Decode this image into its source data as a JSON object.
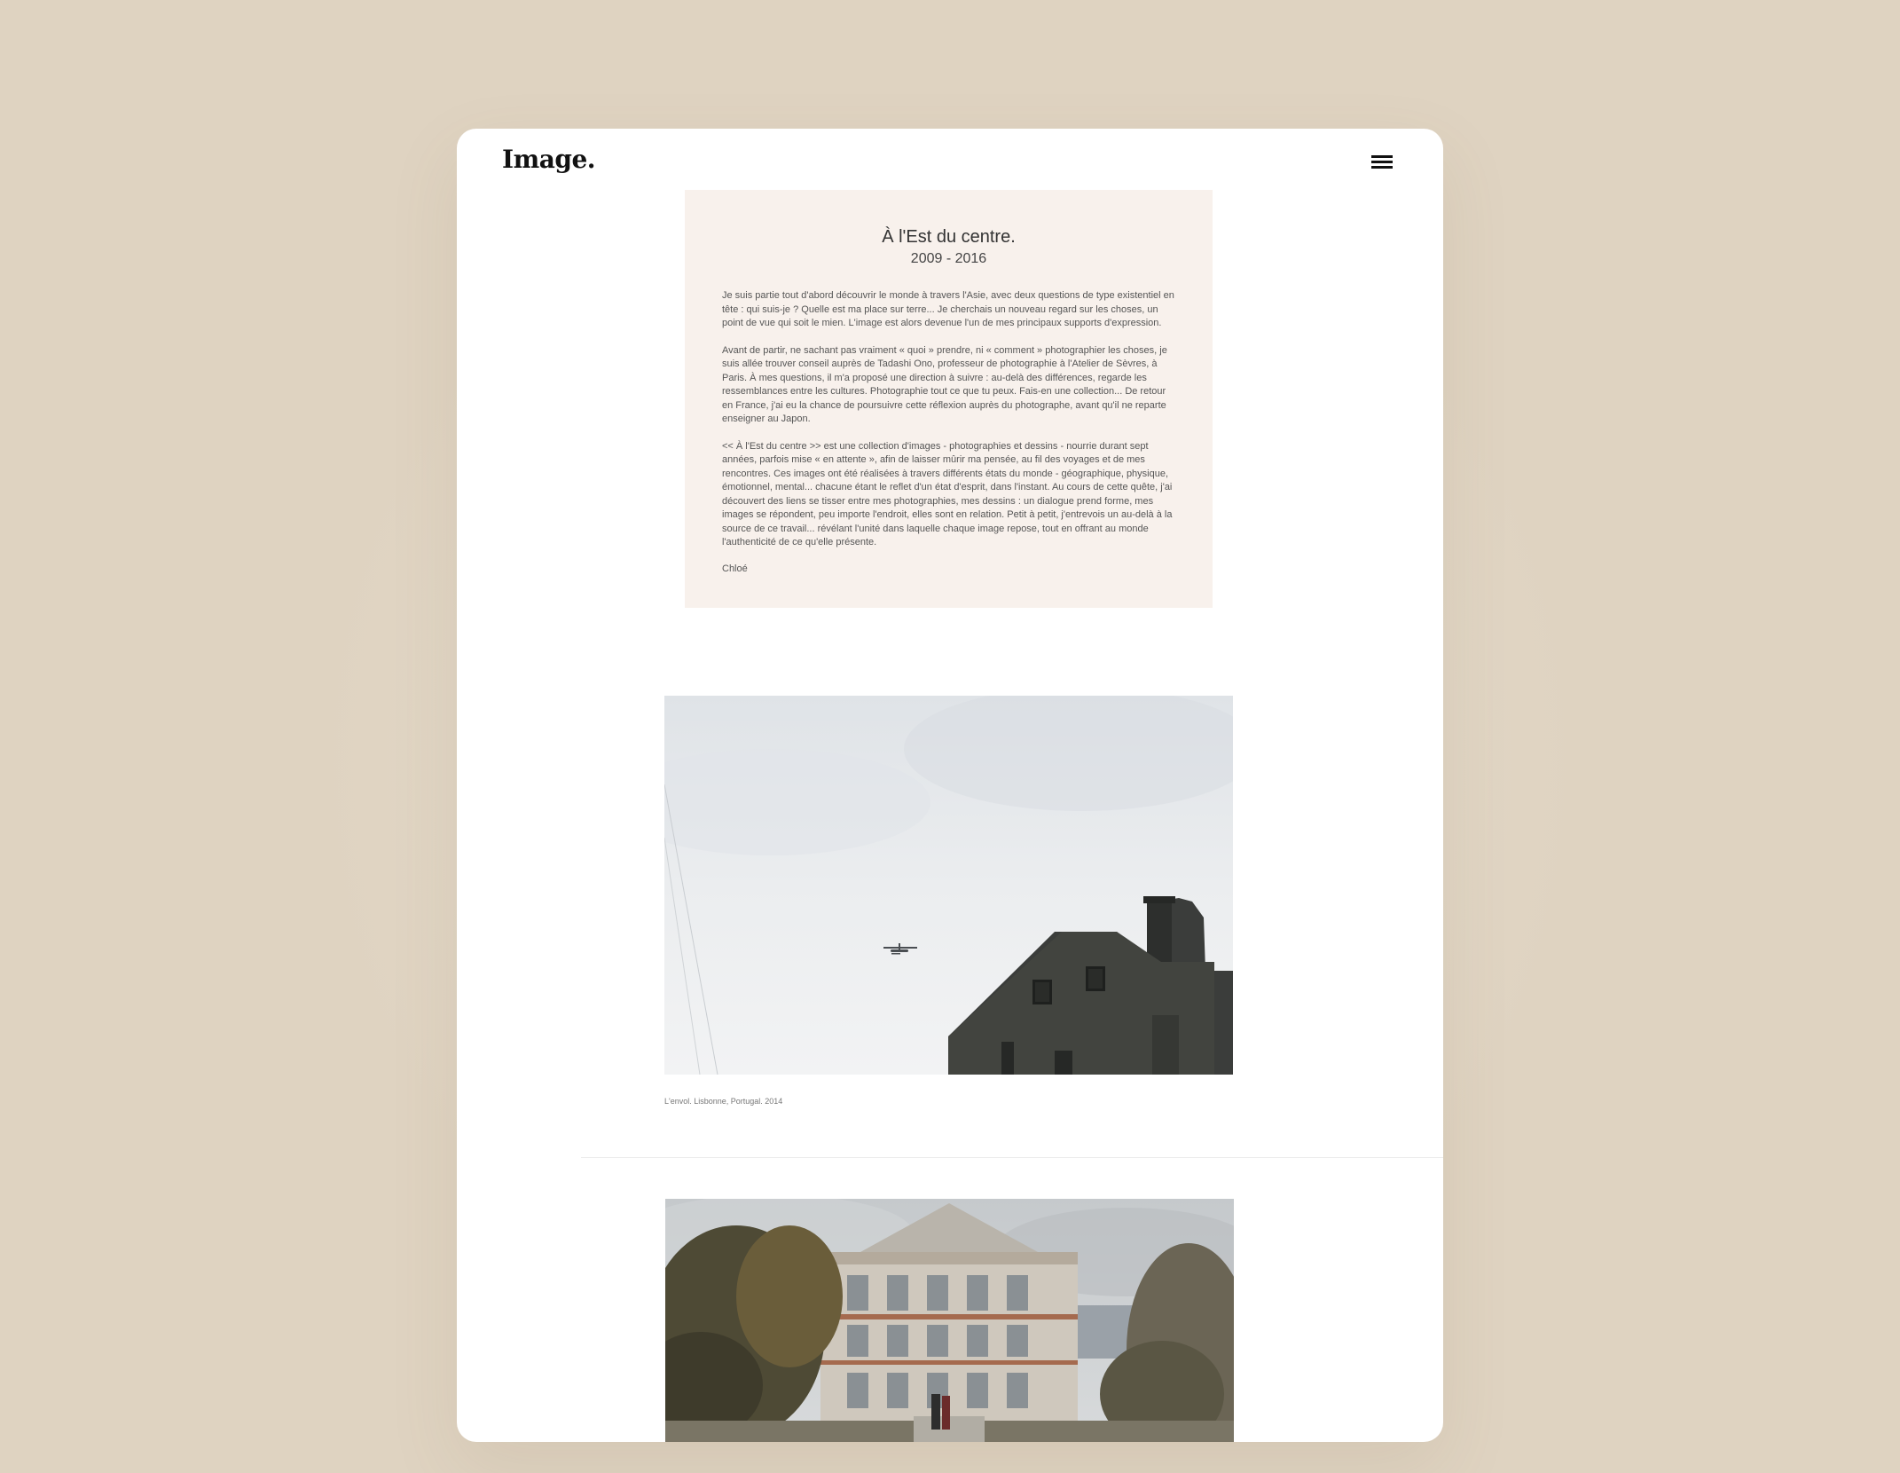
{
  "header": {
    "logo": "Image.",
    "menu_icon": "hamburger-menu-icon"
  },
  "intro": {
    "title": "À l'Est du centre.",
    "years": "2009 - 2016",
    "paragraphs": [
      "Je suis partie tout d'abord découvrir le monde à travers l'Asie, avec deux questions de type existentiel en tête : qui suis-je ? Quelle est ma place sur terre... Je cherchais un nouveau regard sur les choses, un point de vue qui soit le mien. L'image est alors devenue l'un de mes principaux supports d'expression.",
      "Avant de partir, ne sachant pas vraiment « quoi » prendre, ni « comment » photographier les choses, je suis allée trouver conseil auprès de Tadashi Ono, professeur de photographie à l'Atelier de Sèvres, à Paris. À mes questions, il m'a proposé une direction à suivre : au-delà des différences, regarde les ressemblances entre les cultures. Photographie tout ce que tu peux. Fais-en une collection... De retour en France, j'ai eu la chance de poursuivre cette réflexion auprès du photographe, avant qu'il ne reparte enseigner au Japon.",
      "<< À l'Est du centre >> est une collection d'images - photographies et dessins - nourrie durant sept années, parfois mise « en attente », afin de laisser mûrir ma pensée, au fil des voyages et de mes rencontres. Ces images ont été réalisées à travers différents états du monde - géographique, physique, émotionnel, mental... chacune étant le reflet d'un état d'esprit, dans l'instant. Au cours de cette quête, j'ai découvert des liens se tisser entre mes photographies, mes dessins : un dialogue prend forme, mes images se répondent, peu importe l'endroit, elles sont en relation. Petit à petit, j'entrevois un au-delà à la source de ce travail... révélant l'unité dans laquelle chaque image repose, tout en offrant au monde l'authenticité de ce qu'elle présente."
    ],
    "signature": "Chloé"
  },
  "gallery": [
    {
      "caption": "L'envol. Lisbonne, Portugal. 2014"
    },
    {
      "caption": ""
    }
  ]
}
